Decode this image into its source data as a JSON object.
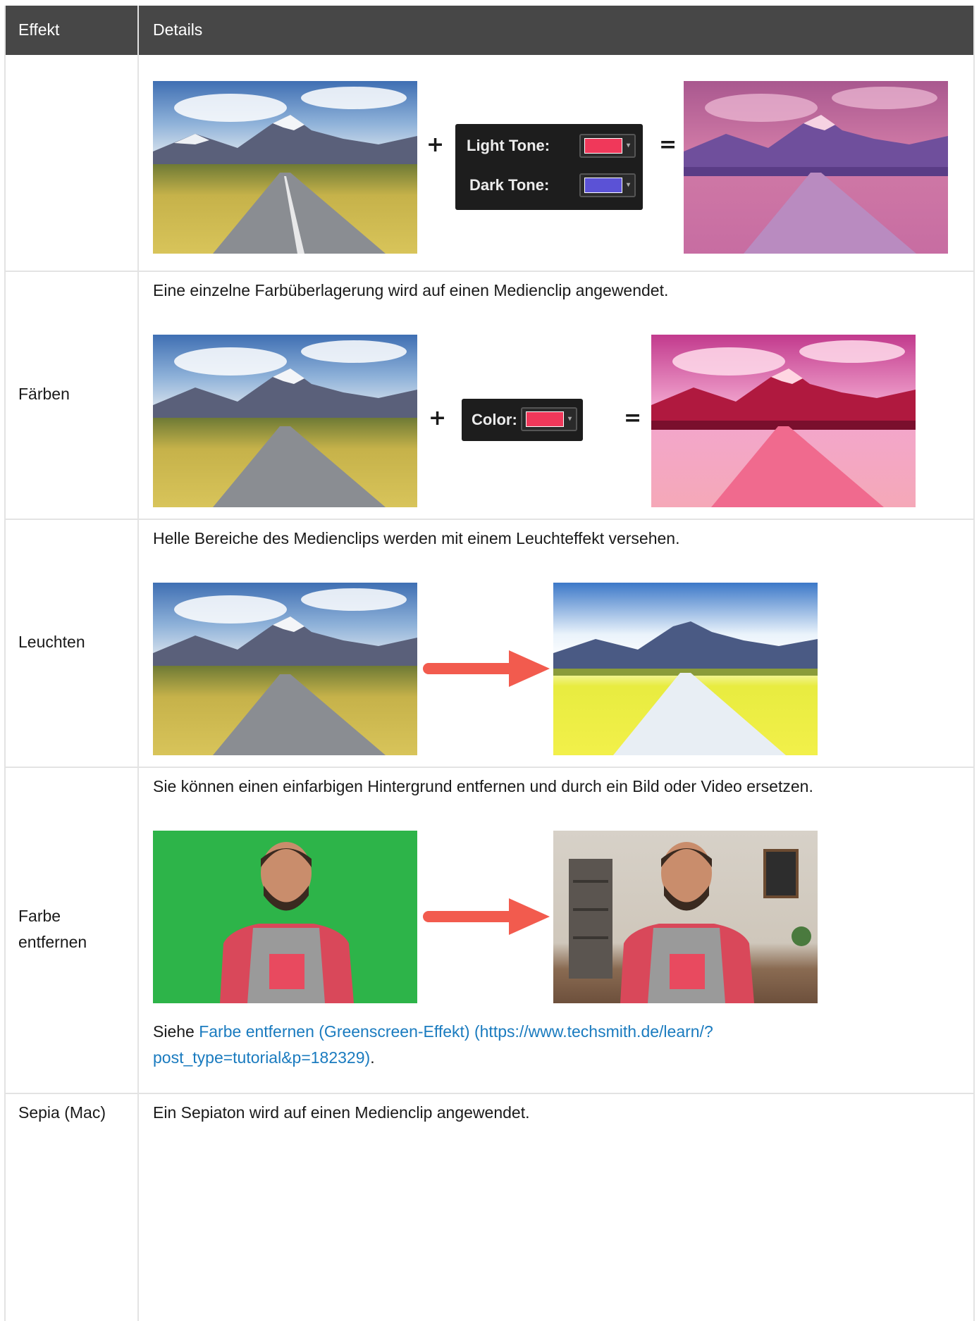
{
  "table": {
    "header": {
      "effekt": "Effekt",
      "details": "Details"
    },
    "rows": [
      {
        "effect": "",
        "description": "",
        "panel": {
          "light_tone_label": "Light Tone:",
          "dark_tone_label": "Dark Tone:",
          "light_tone_color": "#f0385a",
          "dark_tone_color": "#5b52d6"
        },
        "operators": {
          "plus": "+",
          "equals": "="
        }
      },
      {
        "effect": "Färben",
        "description": "Eine einzelne Farbüberlagerung wird auf einen Medienclip angewendet.",
        "panel": {
          "color_label": "Color:",
          "color": "#f0385a"
        },
        "operators": {
          "plus": "+",
          "equals": "="
        }
      },
      {
        "effect": "Leuchten",
        "description": "Helle Bereiche des Medienclips werden mit einem Leuchteffekt versehen."
      },
      {
        "effect_line1": "Farbe",
        "effect_line2": "entfernen",
        "description": "Sie können einen einfarbigen Hintergrund entfernen und durch ein Bild oder Video ersetzen.",
        "see_prefix": "Siehe ",
        "link_line1": "Farbe entfernen (Greenscreen-Effekt) (https://www.techsmith.de/learn/?",
        "link_line2": "post_type=tutorial&p=182329)",
        "see_suffix": "."
      },
      {
        "effect": "Sepia (Mac)",
        "description": "Ein Sepiaton wird auf einen Medienclip angewendet."
      }
    ]
  },
  "colors": {
    "header_bg": "#474747",
    "link": "#1a7bbf",
    "arrow": "#f25b4e",
    "border": "#e3e3e3"
  }
}
